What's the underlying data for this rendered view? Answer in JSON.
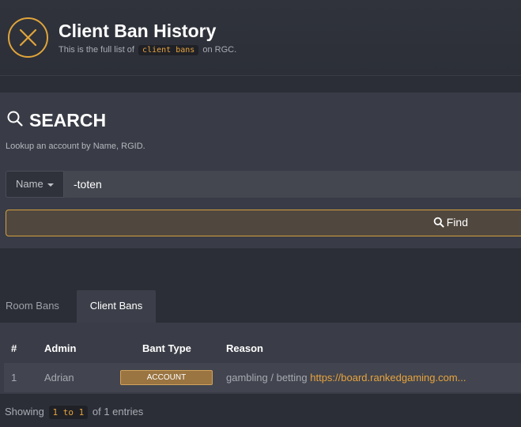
{
  "header": {
    "title": "Client Ban History",
    "subtitle_prefix": "This is the full list of",
    "subtitle_code": "client bans",
    "subtitle_suffix": "on RGC.",
    "logo_icon": "close-circle-icon",
    "accent_color": "#e0a43a"
  },
  "search": {
    "title": "SEARCH",
    "description": "Lookup an account by Name, RGID.",
    "dropdown_value": "Name",
    "input_value": "-toten",
    "find_label": "Find"
  },
  "tabs": [
    {
      "label": "Room Bans",
      "active": false
    },
    {
      "label": "Client Bans",
      "active": true
    }
  ],
  "table": {
    "headers": [
      "#",
      "Admin",
      "Bant Type",
      "Reason"
    ],
    "rows": [
      {
        "num": "1",
        "admin": "Adrian",
        "type": "ACCOUNT",
        "reason_text": "gambling / betting",
        "reason_link": "https://board.rankedgaming.com..."
      }
    ]
  },
  "footer": {
    "showing_prefix": "Showing",
    "range": "1 to 1",
    "showing_suffix": "of 1 entries"
  }
}
